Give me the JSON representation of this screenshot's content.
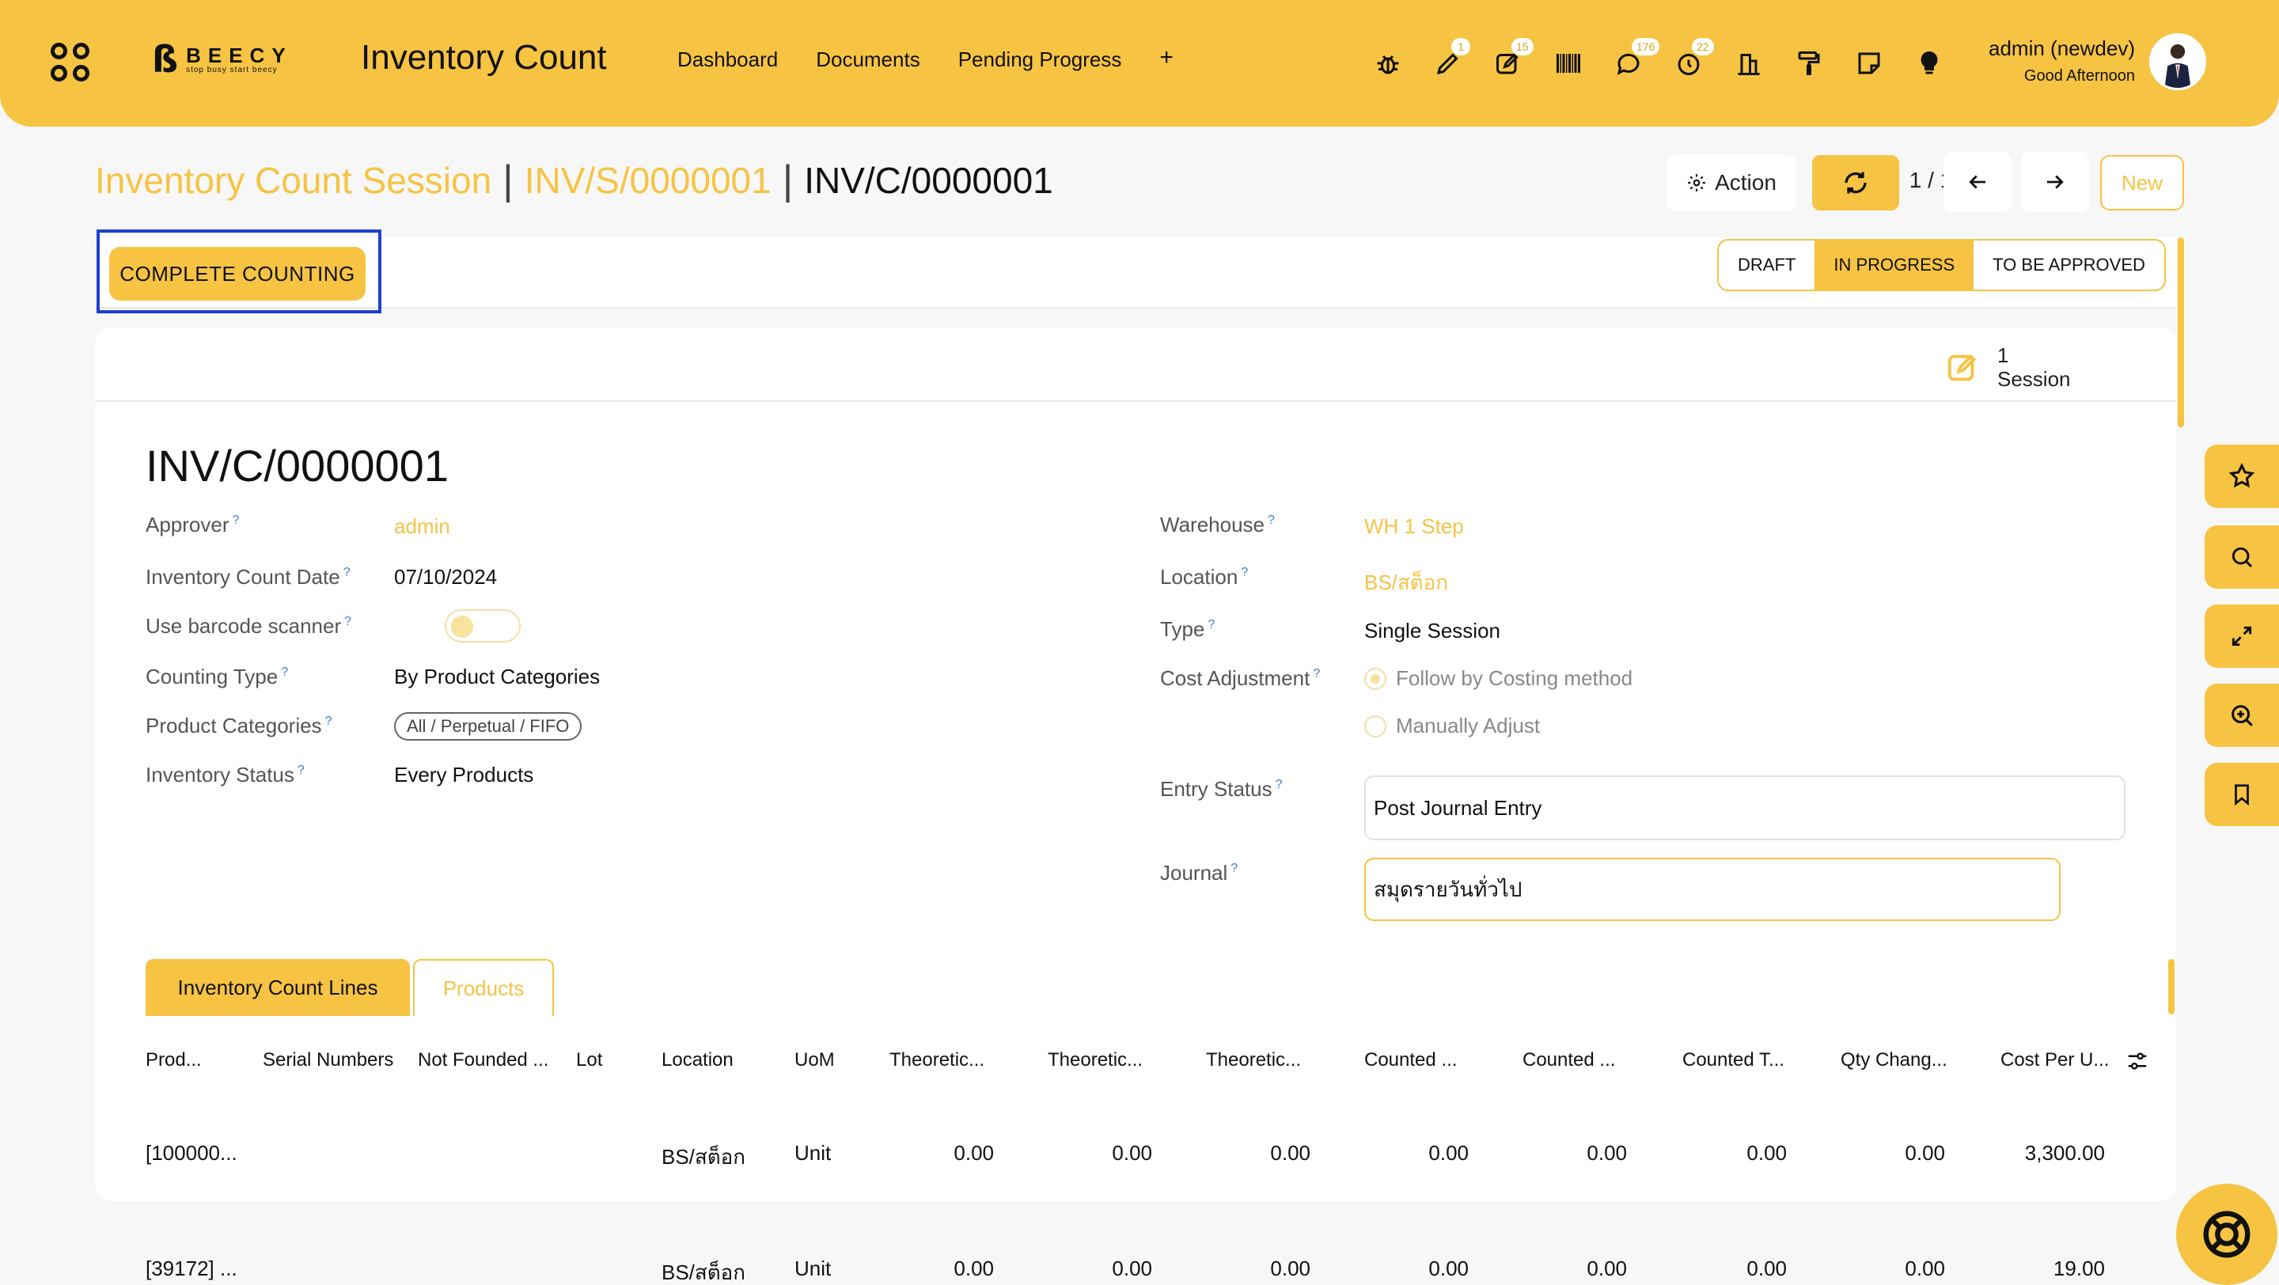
{
  "header": {
    "logo_name": "BEECY",
    "logo_tagline": "stop busy start beecy",
    "app_title": "Inventory Count",
    "nav": [
      "Dashboard",
      "Documents",
      "Pending Progress"
    ],
    "nav_add": "+",
    "icons": [
      {
        "name": "bug-icon",
        "badge": ""
      },
      {
        "name": "pencil-icon",
        "badge": "1"
      },
      {
        "name": "edit-note-icon",
        "badge": "15"
      },
      {
        "name": "barcode-icon",
        "badge": ""
      },
      {
        "name": "chat-icon",
        "badge": "176"
      },
      {
        "name": "timer-icon",
        "badge": "22"
      },
      {
        "name": "building-icon",
        "badge": ""
      },
      {
        "name": "paint-roller-icon",
        "badge": ""
      },
      {
        "name": "sticky-note-icon",
        "badge": ""
      },
      {
        "name": "lightbulb-icon",
        "badge": ""
      }
    ],
    "user_name": "admin (newdev)",
    "greeting": "Good Afternoon"
  },
  "breadcrumb": {
    "level1": "Inventory Count Session",
    "level2": "INV/S/0000001",
    "current": "INV/C/0000001"
  },
  "toolbar": {
    "action_label": "Action",
    "pager": "1 / 1",
    "new_label": "New"
  },
  "statusbar": {
    "complete_label": "COMPLETE COUNTING",
    "stages": [
      "DRAFT",
      "IN PROGRESS",
      "TO BE APPROVED"
    ],
    "active_stage": "IN PROGRESS"
  },
  "smart_button": {
    "count": "1",
    "label": "Session"
  },
  "record": {
    "title": "INV/C/0000001",
    "left": {
      "approver_label": "Approver",
      "approver": "admin",
      "date_label": "Inventory Count Date",
      "date": "07/10/2024",
      "barcode_label": "Use barcode scanner",
      "counting_type_label": "Counting Type",
      "counting_type": "By Product Categories",
      "categories_label": "Product Categories",
      "category_tag": "All / Perpetual / FIFO",
      "status_label": "Inventory Status",
      "status": "Every Products"
    },
    "right": {
      "warehouse_label": "Warehouse",
      "warehouse": "WH 1 Step",
      "location_label": "Location",
      "location": "BS/สต็อก",
      "type_label": "Type",
      "type": "Single Session",
      "cost_adj_label": "Cost Adjustment",
      "cost_opt1": "Follow by Costing method",
      "cost_opt2": "Manually Adjust",
      "entry_status_label": "Entry Status",
      "entry_status": "Post Journal Entry",
      "journal_label": "Journal",
      "journal": "สมุดรายวันทั่วไป"
    }
  },
  "tabs": [
    "Inventory Count Lines",
    "Products"
  ],
  "table": {
    "columns": [
      "Prod...",
      "Serial Numbers",
      "Not Founded ...",
      "Lot",
      "Location",
      "UoM",
      "Theoretic...",
      "Theoretic...",
      "Theoretic...",
      "Counted ...",
      "Counted ...",
      "Counted T...",
      "Qty Chang...",
      "Cost Per U..."
    ],
    "rows": [
      {
        "product": "[100000...",
        "location": "BS/สต็อก",
        "uom": "Unit",
        "vals": [
          "0.00",
          "0.00",
          "0.00",
          "0.00",
          "0.00",
          "0.00",
          "0.00",
          "3,300.00"
        ]
      },
      {
        "product": "[39172] ...",
        "location": "BS/สต็อก",
        "uom": "Unit",
        "vals": [
          "0.00",
          "0.00",
          "0.00",
          "0.00",
          "0.00",
          "0.00",
          "0.00",
          "19.00"
        ]
      }
    ]
  },
  "colors": {
    "accent": "#f6c343",
    "highlight": "#1f3fcf"
  }
}
